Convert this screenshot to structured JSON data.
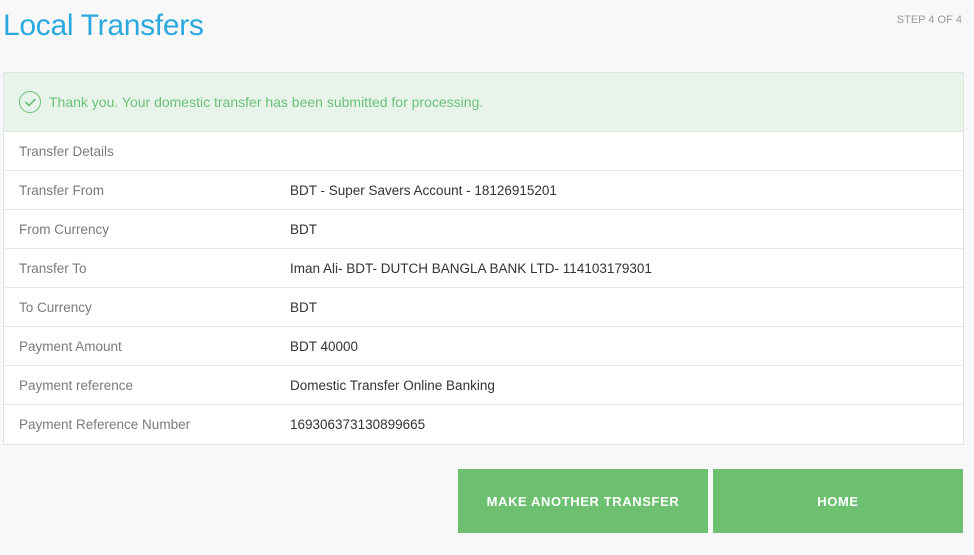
{
  "header": {
    "title": "Local Transfers",
    "step": "STEP 4 OF 4"
  },
  "alert": {
    "icon": "check-circle-icon",
    "message": "Thank you. Your domestic transfer has been submitted for processing."
  },
  "details": {
    "section_title": "Transfer Details",
    "rows": [
      {
        "label": "Transfer From",
        "value": "BDT - Super Savers Account - 18126915201"
      },
      {
        "label": "From Currency",
        "value": "BDT"
      },
      {
        "label": "Transfer To",
        "value": "Iman Ali- BDT- DUTCH BANGLA BANK LTD- 114103179301"
      },
      {
        "label": "To Currency",
        "value": "BDT"
      },
      {
        "label": "Payment Amount",
        "value": "BDT 40000"
      },
      {
        "label": "Payment reference",
        "value": "Domestic Transfer Online Banking"
      },
      {
        "label": "Payment Reference Number",
        "value": "169306373130899665"
      }
    ]
  },
  "actions": {
    "make_another_label": "MAKE ANOTHER TRANSFER",
    "home_label": "HOME"
  },
  "colors": {
    "title": "#2ba9df",
    "success": "#6cc07a",
    "success_bg": "#e8f4ea",
    "button": "#6cc070"
  }
}
